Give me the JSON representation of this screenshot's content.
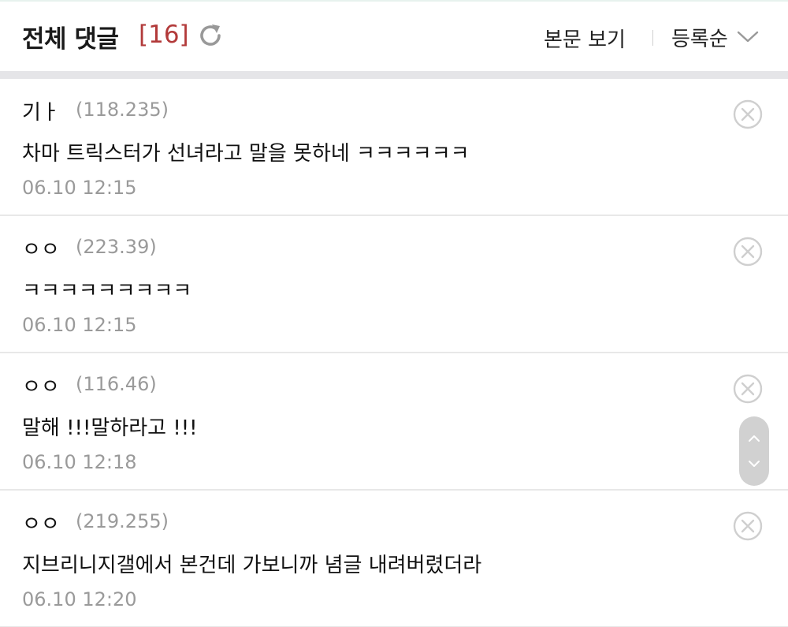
{
  "header": {
    "title": "전체 댓글",
    "count": "[16]",
    "view_post": "본문 보기",
    "sort": "등록순"
  },
  "comments": [
    {
      "nick": "기ㅏ",
      "ip": "(118.235)",
      "body": "차마 트릭스터가 선녀라고 말을 못하네 ㅋㅋㅋㅋㅋㅋ",
      "date": "06.10 12:15"
    },
    {
      "nick": "ㅇㅇ",
      "ip": "(223.39)",
      "body": "ㅋㅋㅋㅋㅋㅋㅋㅋㅋ",
      "date": "06.10 12:15"
    },
    {
      "nick": "ㅇㅇ",
      "ip": "(116.46)",
      "body": "말해 !!!말하라고 !!!",
      "date": "06.10 12:18"
    },
    {
      "nick": "ㅇㅇ",
      "ip": "(219.255)",
      "body": "지브리니지갤에서 본건데 가보니까 념글 내려버렸더라",
      "date": "06.10 12:20"
    }
  ],
  "colors": {
    "accent_count": "#b23a3a",
    "meta_gray": "#9a9a9a",
    "band_gray": "#e5e5e8"
  },
  "icons": {
    "refresh": "refresh-icon",
    "sort_chevron": "chevron-down-icon",
    "delete": "close-circle-icon",
    "scroll_up": "chevron-up-icon",
    "scroll_down": "chevron-down-icon"
  }
}
